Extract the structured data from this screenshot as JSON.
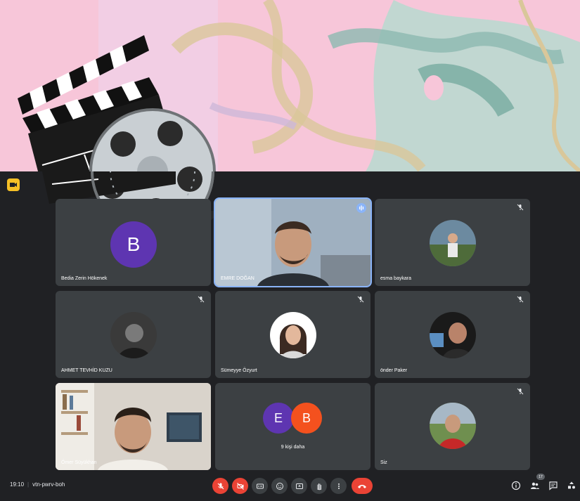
{
  "meeting": {
    "time": "19:10",
    "code": "vtn-pwrv-boh",
    "participant_count": "17"
  },
  "tiles": [
    {
      "name": "Bedia Zerin Hökenek",
      "avatar_letter": "B",
      "avatar_color": "#5e35b1",
      "muted": false
    },
    {
      "name": "EMRE DOĞAN",
      "speaking": true
    },
    {
      "name": "esma baykara",
      "muted": true
    },
    {
      "name": "AHMET TEVHİD KUZU",
      "muted": true
    },
    {
      "name": "Sümeyye Özyurt",
      "muted": true
    },
    {
      "name": "önder Paker",
      "muted": true
    },
    {
      "name": "Ömer Süyükhan",
      "muted": false
    },
    {
      "name": "9 kişi daha",
      "avatars": [
        "E",
        "B"
      ],
      "avatar_colors": [
        "#5e35b1",
        "#f4511e"
      ]
    },
    {
      "name": "Siz",
      "muted": true
    }
  ],
  "controls": [
    "mic-off-icon",
    "camera-off-icon",
    "captions-icon",
    "emoji-icon",
    "present-icon",
    "raise-hand-icon",
    "more-icon",
    "end-call-icon"
  ],
  "right_controls": [
    "info-icon",
    "people-icon",
    "chat-icon",
    "activities-icon"
  ],
  "colors": {
    "accent": "#8ab4f8",
    "danger": "#ea4335",
    "tile": "#3c4043",
    "background": "#202124"
  }
}
